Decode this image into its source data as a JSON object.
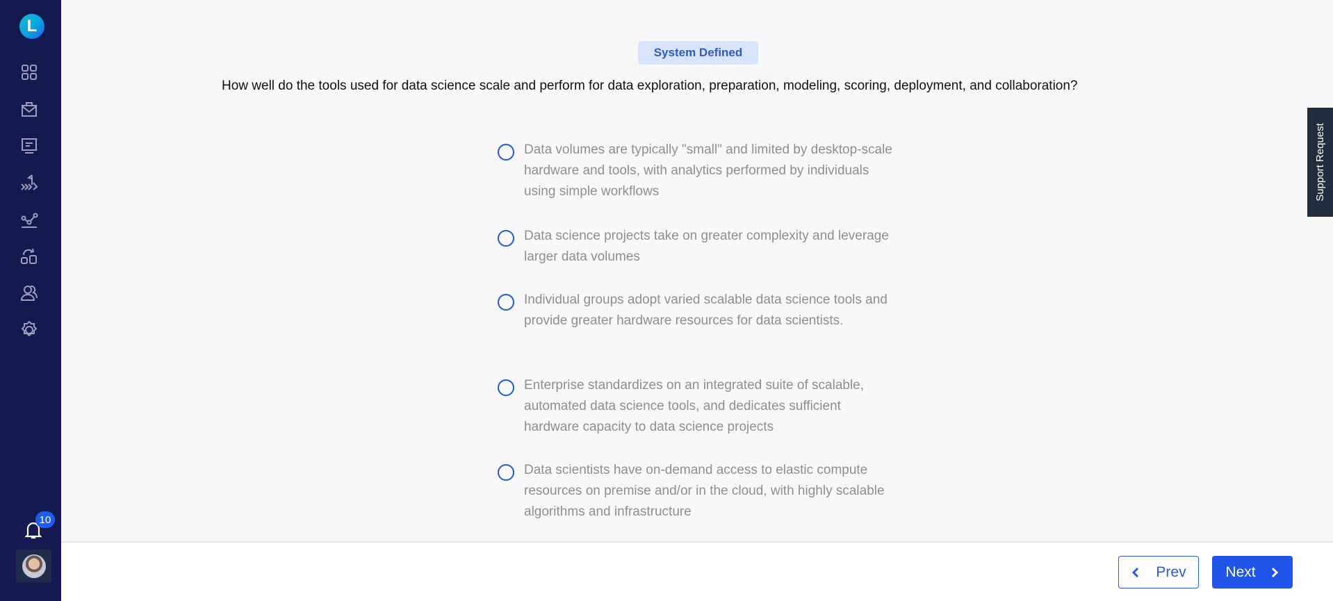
{
  "sidebar": {
    "logo_letter": "L",
    "nav_items": [
      {
        "icon": "dashboard-grid-icon"
      },
      {
        "icon": "briefcase-icon"
      },
      {
        "icon": "presentation-icon"
      },
      {
        "icon": "roadmap-flag-icon"
      },
      {
        "icon": "analytics-line-icon"
      },
      {
        "icon": "transform-blocks-icon"
      },
      {
        "icon": "users-icon"
      },
      {
        "icon": "settings-gear-icon"
      }
    ],
    "notifications": {
      "icon": "bell-icon",
      "count": "10"
    },
    "avatar": {
      "icon": "user-avatar"
    }
  },
  "main": {
    "tag": "System Defined",
    "question": "How well do the tools used for data science scale and perform for data exploration, preparation, modeling, scoring, deployment, and collaboration?",
    "options": [
      {
        "label": "Data volumes are typically \"small\" and limited by desktop-scale hardware and tools, with analytics performed by individuals using simple workflows",
        "selected": false
      },
      {
        "label": "Data science projects take on greater complexity and leverage larger data volumes",
        "selected": false
      },
      {
        "label": "Individual groups adopt varied scalable data science tools and provide greater hardware resources for data scientists.",
        "selected": false
      },
      {
        "label": "Enterprise standardizes on an integrated suite of scalable, automated data science tools, and dedicates sufficient hardware capacity to data science projects",
        "selected": false
      },
      {
        "label": "Data scientists have on-demand access to elastic compute resources on premise and/or in the cloud, with highly scalable algorithms and infrastructure",
        "selected": false
      }
    ]
  },
  "support_tab": "Support Request",
  "footer": {
    "prev_label": "Prev",
    "next_label": "Next"
  },
  "colors": {
    "sidebar_bg": "#141a4f",
    "accent": "#2155ea",
    "tag_bg": "#d8e3fc",
    "tag_text": "#2b5cc4",
    "support_bg": "#222e3e"
  }
}
